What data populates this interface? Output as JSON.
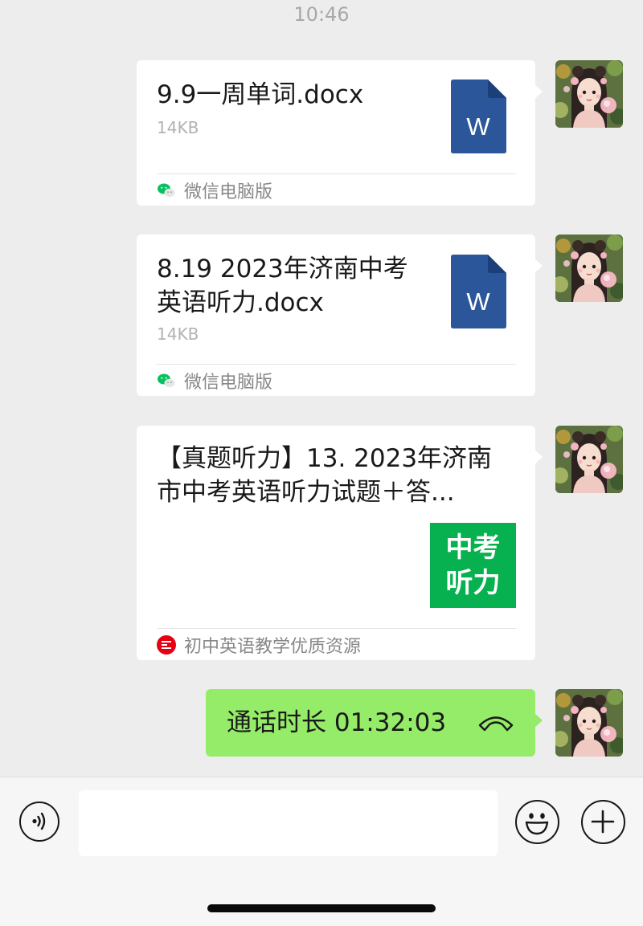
{
  "status": {
    "time": "10:46"
  },
  "messages": [
    {
      "type": "file",
      "file_name": "9.9一周单词.docx",
      "file_size": "14KB",
      "file_icon": "word-doc-icon",
      "file_icon_letter": "W",
      "source_icon": "wechat-icon",
      "source": "微信电脑版"
    },
    {
      "type": "file",
      "file_name": "8.19 2023年济南中考英语听力.docx",
      "file_size": "14KB",
      "file_icon": "word-doc-icon",
      "file_icon_letter": "W",
      "source_icon": "wechat-icon",
      "source": "微信电脑版"
    },
    {
      "type": "article",
      "title": "【真题听力】13. 2023年济南市中考英语听力试题＋答...",
      "thumbnail_line1": "中考",
      "thumbnail_line2": "听力",
      "source_icon": "official-account-icon",
      "source": "初中英语教学优质资源"
    },
    {
      "type": "call",
      "text": "通话时长 01:32:03",
      "icon": "phone-hangup-icon"
    }
  ],
  "input_bar": {
    "voice_icon": "voice-icon",
    "emoji_icon": "emoji-icon",
    "more_icon": "plus-icon"
  },
  "colors": {
    "background": "#ededed",
    "bubble": "#ffffff",
    "sent_bubble": "#95ec69",
    "word_icon": "#2b579a",
    "thumbnail": "#07b14f"
  }
}
